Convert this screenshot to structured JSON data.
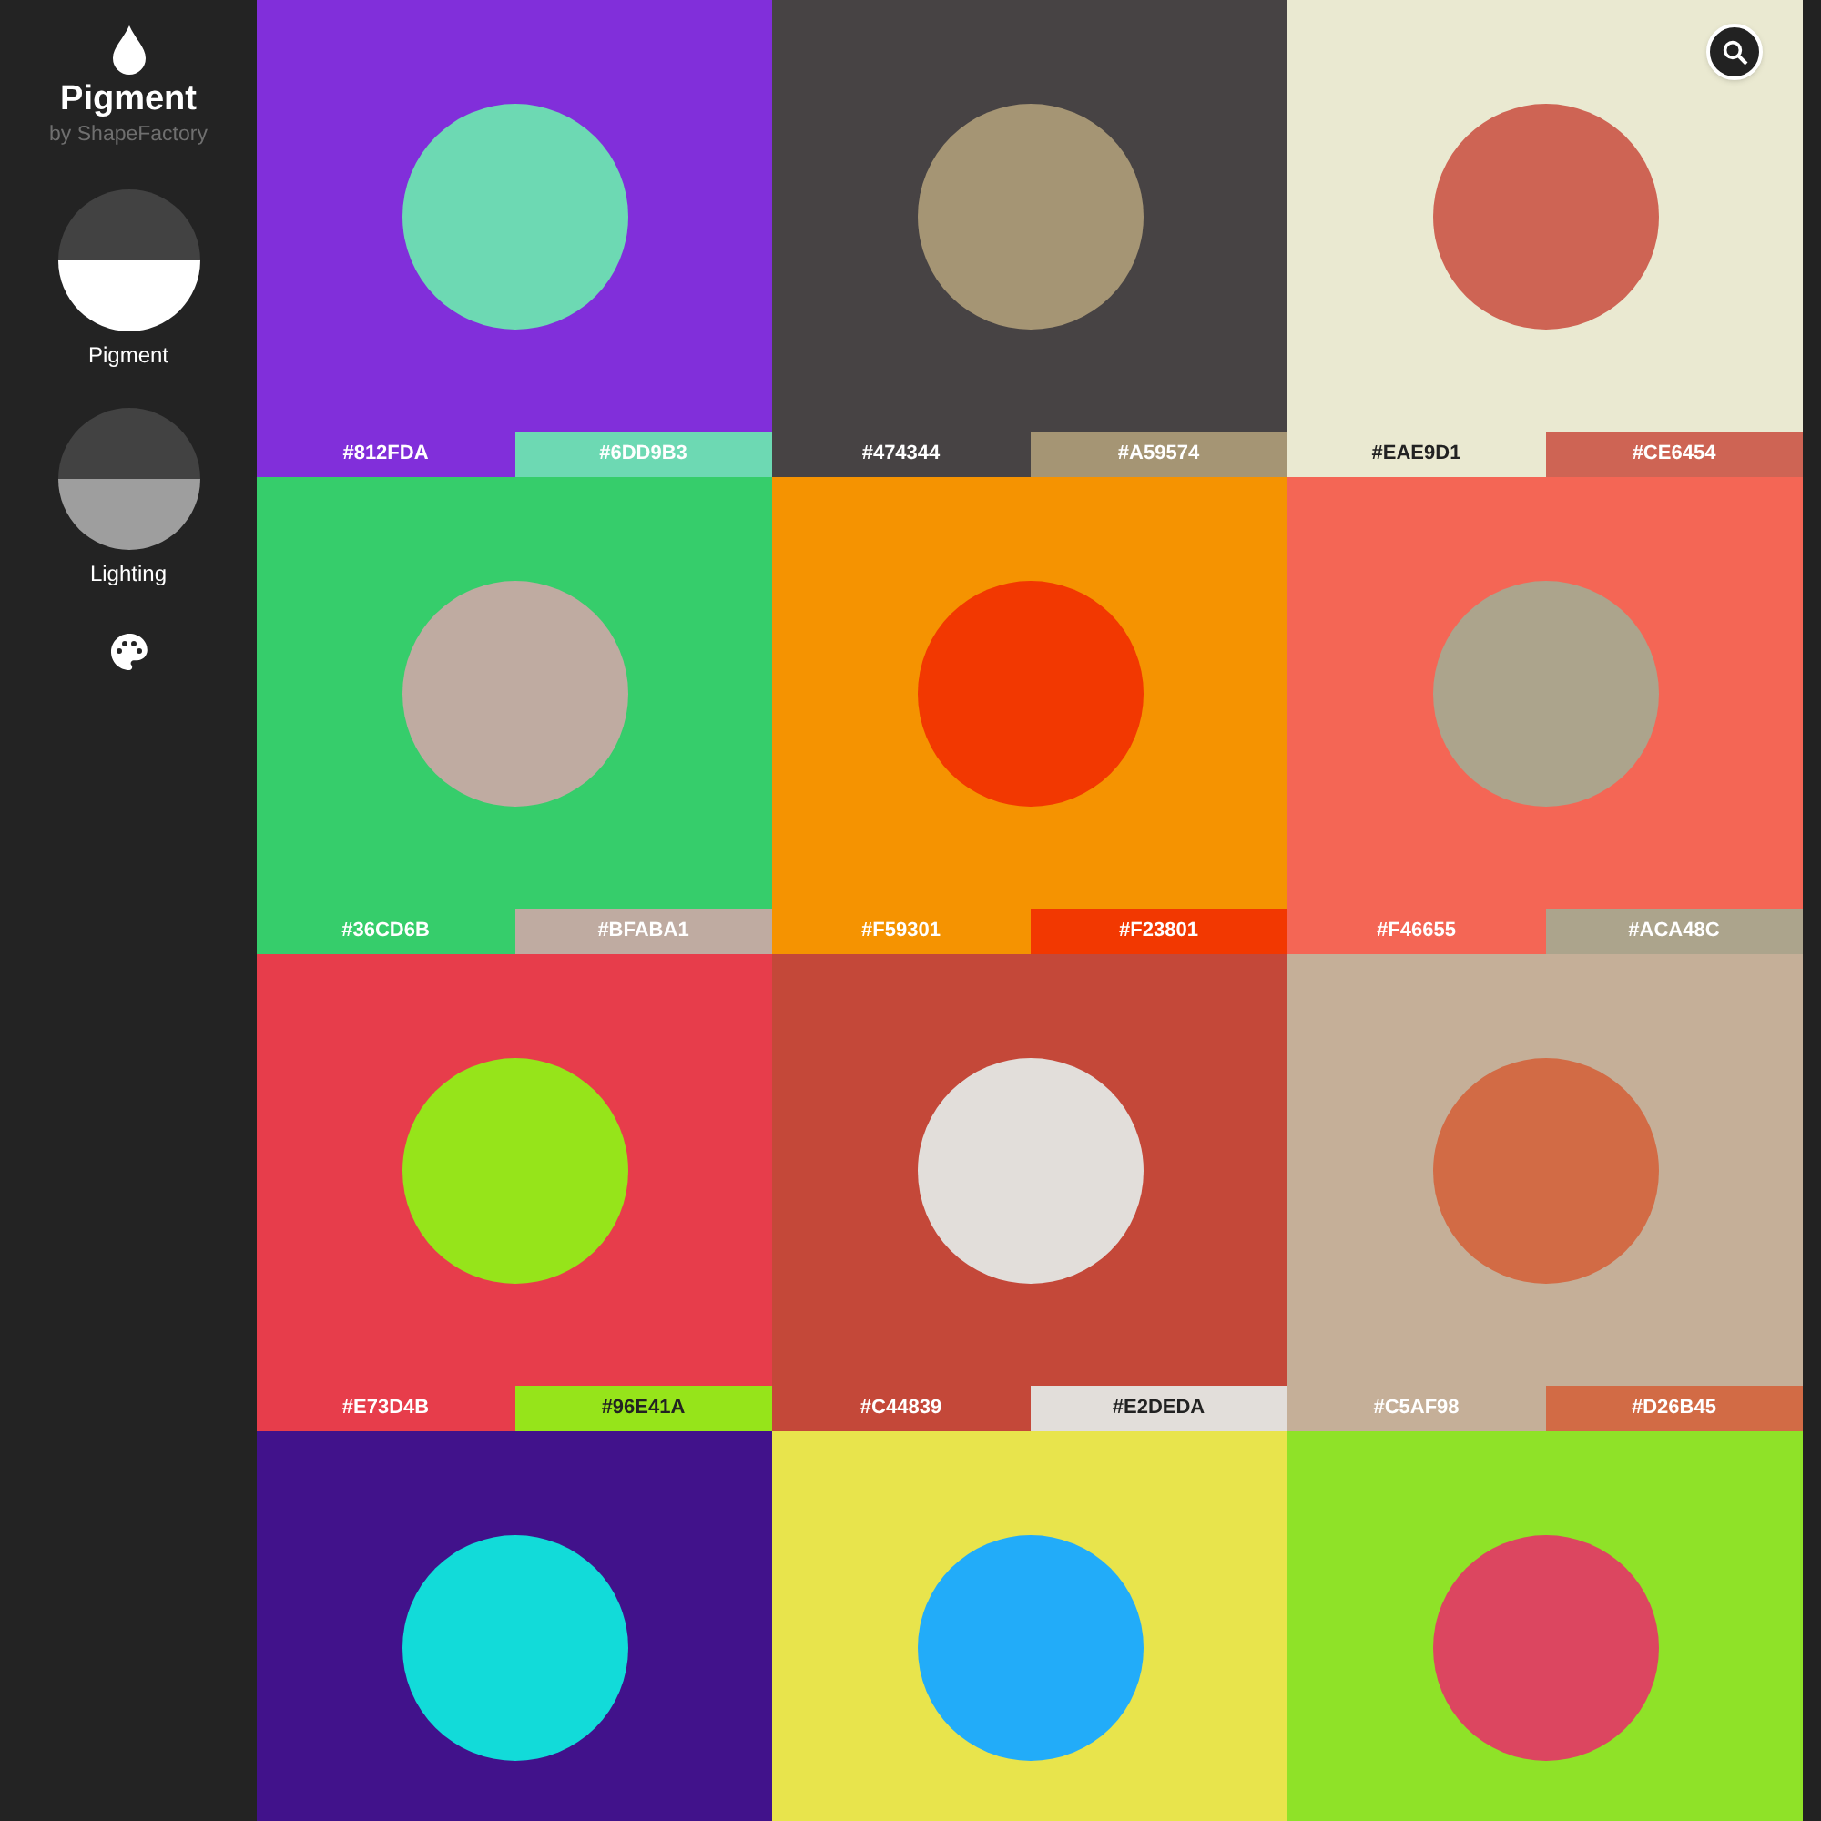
{
  "app": {
    "title": "Pigment",
    "subtitle": "by ShapeFactory"
  },
  "sidebar": {
    "items": [
      {
        "label": "Pigment",
        "selected": true
      },
      {
        "label": "Lighting",
        "selected": false
      }
    ]
  },
  "tiles": [
    {
      "color": "#812fda",
      "circle": {
        "color": "#6dd9b3"
      },
      "labels": [
        {
          "text": "#812FDA",
          "color": "#812fda",
          "dark": false
        },
        {
          "text": "#6DD9B3",
          "color": "#6dd9b3",
          "dark": false
        }
      ]
    },
    {
      "color": "#474344",
      "circle": {
        "color": "#a59574"
      },
      "labels": [
        {
          "text": "#474344",
          "color": "#474344",
          "dark": false
        },
        {
          "text": "#A59574",
          "color": "#a59574",
          "dark": false
        }
      ]
    },
    {
      "color": "#eae9d1",
      "circle": {
        "color": "#ce6454"
      },
      "labels": [
        {
          "text": "#EAE9D1",
          "color": "#eae9d1",
          "dark": true
        },
        {
          "text": "#CE6454",
          "color": "#ce6454",
          "dark": false
        }
      ]
    },
    {
      "color": "#36cd6b",
      "circle": {
        "color": "#bfaba1"
      },
      "labels": [
        {
          "text": "#36CD6B",
          "color": "#36cd6b",
          "dark": false
        },
        {
          "text": "#BFABA1",
          "color": "#bfaba1",
          "dark": false
        }
      ]
    },
    {
      "color": "#f59301",
      "circle": {
        "color": "#f23801"
      },
      "labels": [
        {
          "text": "#F59301",
          "color": "#f59301",
          "dark": false
        },
        {
          "text": "#F23801",
          "color": "#f23801",
          "dark": false
        }
      ]
    },
    {
      "color": "#f46655",
      "circle": {
        "color": "#aca48c"
      },
      "labels": [
        {
          "text": "#F46655",
          "color": "#f46655",
          "dark": false
        },
        {
          "text": "#ACA48C",
          "color": "#aca48c",
          "dark": false
        }
      ]
    },
    {
      "color": "#e73d4b",
      "circle": {
        "color": "#96e41a"
      },
      "labels": [
        {
          "text": "#E73D4B",
          "color": "#e73d4b",
          "dark": false
        },
        {
          "text": "#96E41A",
          "color": "#96e41a",
          "dark": true
        }
      ]
    },
    {
      "color": "#c44839",
      "circle": {
        "color": "#e2deda"
      },
      "labels": [
        {
          "text": "#C44839",
          "color": "#c44839",
          "dark": false
        },
        {
          "text": "#E2DEDA",
          "color": "#e2deda",
          "dark": true
        }
      ]
    },
    {
      "color": "#c5af98",
      "circle": {
        "color": "#d26b45"
      },
      "labels": [
        {
          "text": "#C5AF98",
          "color": "#c5af98",
          "dark": false
        },
        {
          "text": "#D26B45",
          "color": "#d26b45",
          "dark": false
        }
      ]
    },
    {
      "color": "#41128b",
      "circle": {
        "color": "#12dbd9"
      }
    },
    {
      "color": "#e8e44c",
      "circle": {
        "color": "#22acf9"
      }
    },
    {
      "color": "#8fe228",
      "circle": {
        "color": "#dc4660"
      }
    }
  ]
}
